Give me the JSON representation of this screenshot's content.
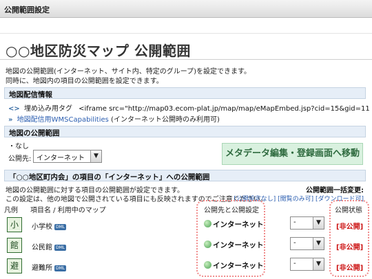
{
  "window": {
    "title": "公開範囲設定"
  },
  "page": {
    "heading": "○○地区防災マップ 公開範囲",
    "intro_line1": "地図の公開範囲(インターネット、サイト内、特定のグループ)を設定できます。",
    "intro_line2": "同時に、地図内の項目の公開範囲を設定できます。"
  },
  "distribution": {
    "header": "地図配信情報",
    "embed_label": "埋め込み用タグ",
    "embed_code": "<iframe src=\"http://map03.ecom-plat.jp/map/map/eMapEmbed.jsp?cid=15&gid=11",
    "wms_link": "地図配信用WMSCapabilities",
    "wms_note": "(インターネット公開時のみ利用可)"
  },
  "map_scope": {
    "header": "地図の公開範囲",
    "current": "・なし",
    "scope_label": "公開先:",
    "scope_value": "インターネット",
    "meta_button": "メタデータ編集・登録画面へ移動"
  },
  "items_scope": {
    "header": "「○○地区町内会」の項目の「インターネット」への公開範囲",
    "desc_line1": "地図の公開範囲に対する項目の公開範囲が設定できます。",
    "desc_line2": "この設定は、他の地図で公開されている項目にも反映されますのでご注意ください。",
    "bulk_label": "公開範囲一括変更:",
    "bulk_links": "[公開設定なし] [閲覧のみ可] [ダウンロード可]",
    "columns": {
      "legend": "凡例",
      "name": "項目名 / 利用中のマップ",
      "publish": "公開先と公開設定",
      "status": "公開状態"
    },
    "rows": [
      {
        "name": "小学校",
        "badge": "DML",
        "target": "インターネット",
        "option": "-",
        "status": "[非公開]",
        "icon": "school-icon"
      },
      {
        "name": "公民館",
        "badge": "DML",
        "target": "インターネット",
        "option": "-",
        "status": "[非公開]",
        "icon": "community-hall-icon"
      },
      {
        "name": "避難所",
        "badge": "DML",
        "target": "インターネット",
        "option": "-",
        "status": "[非公開]",
        "icon": "shelter-icon"
      }
    ]
  },
  "colors": {
    "highlight_dots": "#f08a8a",
    "private": "#cc1111",
    "section_bg": "#e6eef7",
    "meta_button_bg": "#d9f1df"
  }
}
